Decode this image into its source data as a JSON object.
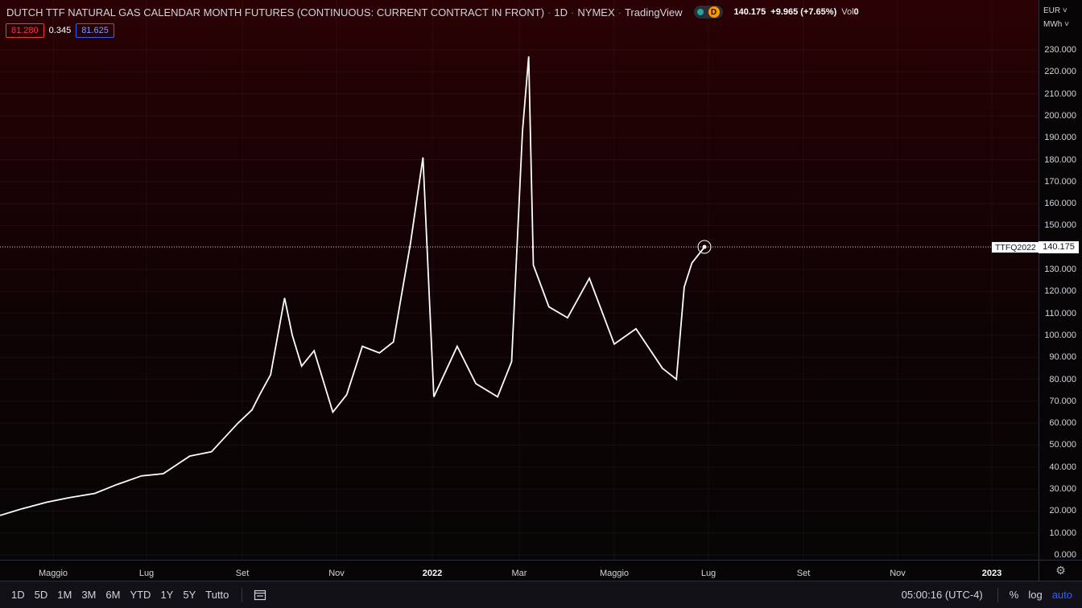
{
  "header": {
    "title": "DUTCH TTF NATURAL GAS CALENDAR MONTH FUTURES (CONTINUOUS: CURRENT CONTRACT IN FRONT)",
    "interval": "1D",
    "exchange": "NYMEX",
    "source": "TradingView",
    "badge": "D",
    "last_price": "140.175",
    "change": "+9.965 (+7.65%)",
    "vol_label": "Vol",
    "vol_value": "0"
  },
  "spread": {
    "bid": "81.280",
    "spread": "0.345",
    "ask": "81.625"
  },
  "currency": {
    "unit": "EUR",
    "measure": "MWh"
  },
  "price_axis": [
    "230.000",
    "220.000",
    "210.000",
    "200.000",
    "190.000",
    "180.000",
    "170.000",
    "160.000",
    "150.000",
    "140.000",
    "130.000",
    "120.000",
    "110.000",
    "100.000",
    "90.000",
    "80.000",
    "70.000",
    "60.000",
    "50.000",
    "40.000",
    "30.000",
    "20.000",
    "10.000",
    "0.000"
  ],
  "time_axis": [
    {
      "label": "Maggio",
      "year": false
    },
    {
      "label": "Lug",
      "year": false
    },
    {
      "label": "Set",
      "year": false
    },
    {
      "label": "Nov",
      "year": false
    },
    {
      "label": "2022",
      "year": true
    },
    {
      "label": "Mar",
      "year": false
    },
    {
      "label": "Maggio",
      "year": false
    },
    {
      "label": "Lug",
      "year": false
    },
    {
      "label": "Set",
      "year": false
    },
    {
      "label": "Nov",
      "year": false
    },
    {
      "label": "2023",
      "year": true
    }
  ],
  "price_tag": {
    "symbol": "TTFQ2022",
    "price": "140.175"
  },
  "bottom_bar": {
    "ranges": [
      "1D",
      "5D",
      "1M",
      "3M",
      "6M",
      "YTD",
      "1Y",
      "5Y",
      "Tutto"
    ],
    "clock": "05:00:16 (UTC-4)",
    "percent": "%",
    "log": "log",
    "auto": "auto"
  },
  "colors": {
    "line": "#ffffff",
    "bg_top": "#2a0205",
    "bg_bottom": "#070505",
    "accent": "#2962ff"
  },
  "chart_data": {
    "type": "line",
    "series": [
      {
        "x": [
          "2021-04-01",
          "2021-04-15",
          "2021-05-01",
          "2021-05-15",
          "2021-06-01",
          "2021-06-15",
          "2021-07-01",
          "2021-07-15",
          "2021-08-01",
          "2021-08-15",
          "2021-09-01",
          "2021-09-10",
          "2021-09-15",
          "2021-09-22",
          "2021-10-01",
          "2021-10-06",
          "2021-10-12",
          "2021-10-20",
          "2021-11-01",
          "2021-11-10",
          "2021-11-20",
          "2021-12-01",
          "2021-12-10",
          "2021-12-21",
          "2021-12-29",
          "2022-01-05",
          "2022-01-20",
          "2022-02-01",
          "2022-02-15",
          "2022-02-24",
          "2022-03-03",
          "2022-03-07",
          "2022-03-10",
          "2022-03-20",
          "2022-04-01",
          "2022-04-15",
          "2022-05-01",
          "2022-05-15",
          "2022-06-01",
          "2022-06-10",
          "2022-06-15",
          "2022-06-20",
          "2022-06-28"
        ],
        "y": [
          18,
          21,
          24,
          26,
          28,
          32,
          36,
          37,
          45,
          47,
          60,
          66,
          73,
          82,
          117,
          100,
          86,
          93,
          65,
          73,
          95,
          92,
          97,
          142,
          181,
          72,
          95,
          78,
          72,
          88,
          193,
          227,
          132,
          113,
          108,
          126,
          96,
          103,
          85,
          80,
          122,
          133,
          140.175
        ]
      }
    ],
    "ylim": [
      0,
      235
    ]
  }
}
